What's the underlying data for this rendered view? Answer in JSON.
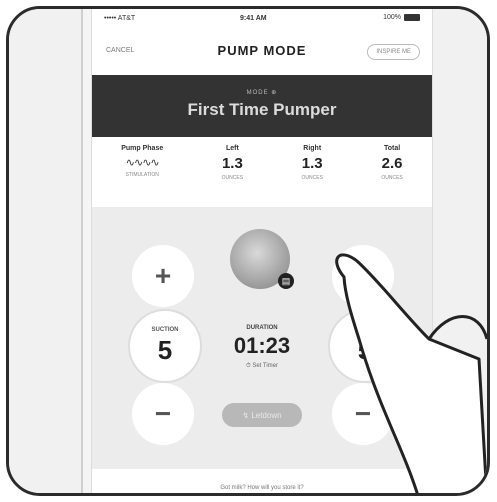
{
  "status": {
    "carrier": "••••• AT&T",
    "time": "9:41 AM",
    "battery": "100%"
  },
  "nav": {
    "cancel": "CANCEL",
    "title": "PUMP MODE",
    "inspire": "INSPIRE ME"
  },
  "mode": {
    "label": "MODE ⊕",
    "name": "First Time Pumper"
  },
  "stats": [
    {
      "label": "Pump Phase",
      "value": "∿∿∿∿",
      "unit": "STIMULATION"
    },
    {
      "label": "Left",
      "value": "1.3",
      "unit": "OUNCES"
    },
    {
      "label": "Right",
      "value": "1.3",
      "unit": "OUNCES"
    },
    {
      "label": "Total",
      "value": "2.6",
      "unit": "OUNCES"
    }
  ],
  "controls": {
    "plus": "+",
    "minus": "−",
    "suction_label": "SUCTION",
    "suction_value": "5",
    "right_label": "SU",
    "right_value": "5",
    "duration_label": "DURATION",
    "duration_value": "01:23",
    "timer_label": "⏱ Set Timer",
    "letdown": "↯ Letdown"
  },
  "bottom": {
    "question": "Got milk? How will you store it?"
  },
  "colors": {
    "mode_bg": "#333333",
    "control_bg": "#ececec"
  }
}
